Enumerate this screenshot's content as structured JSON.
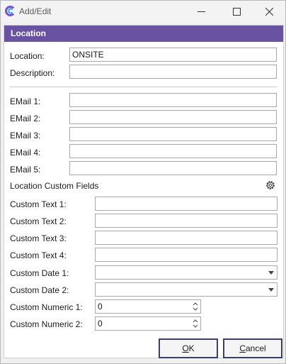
{
  "window": {
    "title": "Add/Edit"
  },
  "header": {
    "title": "Location"
  },
  "location": {
    "label": "Location:",
    "value": "ONSITE",
    "description_label": "Description:",
    "description_value": ""
  },
  "emails": [
    {
      "label": "EMail 1:",
      "value": ""
    },
    {
      "label": "EMail 2:",
      "value": ""
    },
    {
      "label": "EMail 3:",
      "value": ""
    },
    {
      "label": "EMail 4:",
      "value": ""
    },
    {
      "label": "EMail 5:",
      "value": ""
    }
  ],
  "custom": {
    "section_label": "Location Custom Fields",
    "texts": [
      {
        "label": "Custom Text 1:",
        "value": ""
      },
      {
        "label": "Custom Text 2:",
        "value": ""
      },
      {
        "label": "Custom Text 3:",
        "value": ""
      },
      {
        "label": "Custom Text 4:",
        "value": ""
      }
    ],
    "dates": [
      {
        "label": "Custom Date 1:",
        "value": ""
      },
      {
        "label": "Custom Date 2:",
        "value": ""
      }
    ],
    "numerics": [
      {
        "label": "Custom Numeric 1:",
        "value": "0"
      },
      {
        "label": "Custom Numeric 2:",
        "value": "0"
      }
    ]
  },
  "buttons": {
    "ok_first": "O",
    "ok_rest": "K",
    "cancel_first": "C",
    "cancel_rest": "ancel"
  },
  "icons": {
    "app": "app-logo-icon",
    "minimize": "minimize-icon",
    "maximize": "maximize-icon",
    "close": "close-icon",
    "settings": "gear-icon",
    "dropdown": "chevron-down-icon",
    "spinner": "spinner-arrows-icon"
  },
  "colors": {
    "header_bg": "#6a52a3",
    "app_icon_primary": "#7b4fd6",
    "app_icon_secondary": "#2aa6e0",
    "button_border": "#3e3e6e"
  }
}
